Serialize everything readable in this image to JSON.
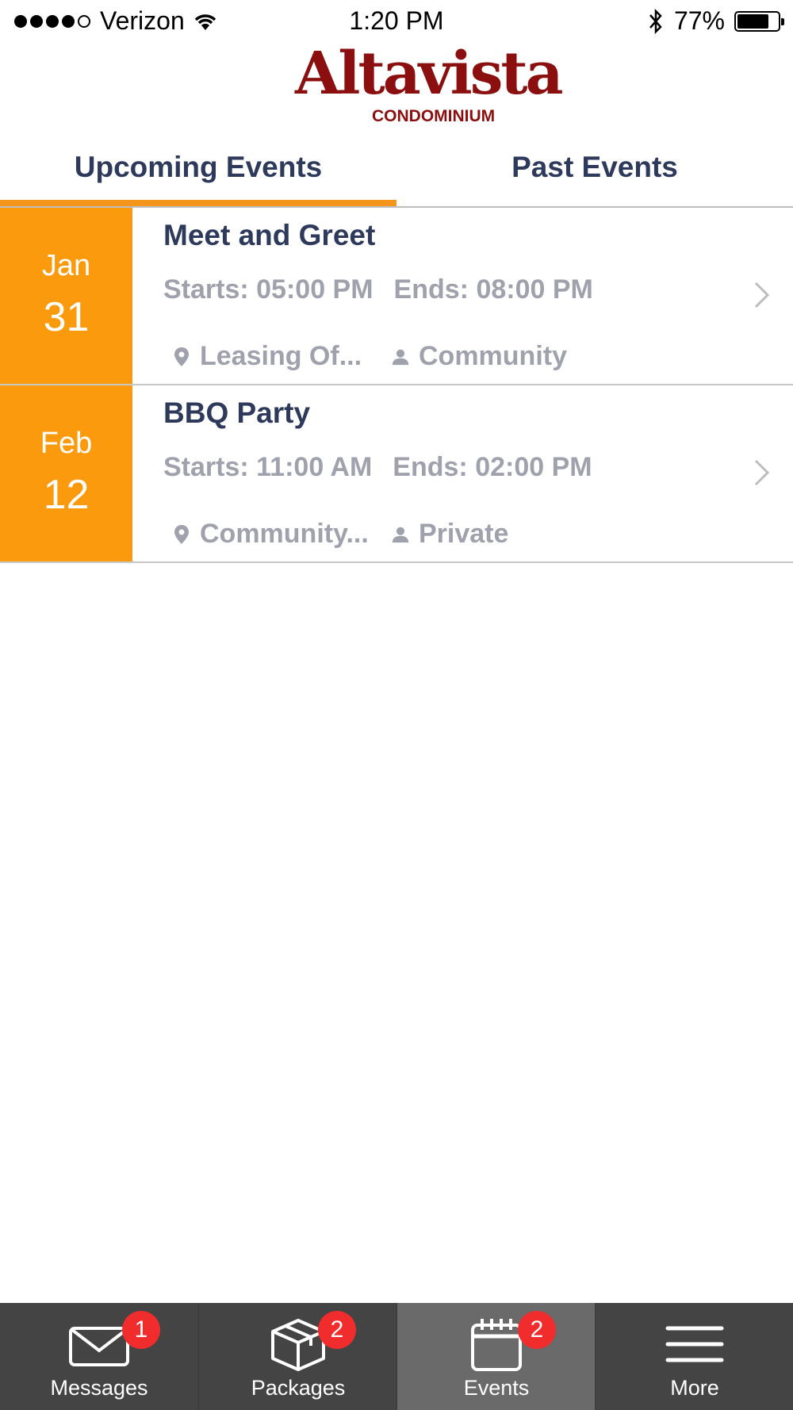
{
  "status_bar": {
    "carrier": "Verizon",
    "time": "1:20 PM",
    "battery_percent": "77%",
    "battery_level": 0.77,
    "signal_bars": 4,
    "signal_max": 5
  },
  "logo": {
    "main": "Altavista",
    "sub": "CONDOMINIUM",
    "color": "#8b0f0f"
  },
  "tabs": {
    "upcoming": "Upcoming Events",
    "past": "Past Events",
    "active": "upcoming",
    "accent": "#f5951b"
  },
  "events": [
    {
      "month": "Jan",
      "day": "31",
      "title": "Meet and Greet",
      "starts": "Starts: 05:00 PM",
      "ends": "Ends: 08:00 PM",
      "location": "Leasing Of...",
      "category": "Community"
    },
    {
      "month": "Feb",
      "day": "12",
      "title": "BBQ Party",
      "starts": "Starts: 11:00 AM",
      "ends": "Ends: 02:00 PM",
      "location": "Community...",
      "category": "Private"
    }
  ],
  "tab_bar": {
    "messages": {
      "label": "Messages",
      "badge": "1",
      "icon": "envelope-icon"
    },
    "packages": {
      "label": "Packages",
      "badge": "2",
      "icon": "box-icon"
    },
    "events": {
      "label": "Events",
      "badge": "2",
      "icon": "calendar-icon"
    },
    "more": {
      "label": "More",
      "icon": "menu-icon"
    },
    "active": "events"
  },
  "colors": {
    "date_block": "#fb9a0d",
    "title_text": "#2e3a5c",
    "meta_text": "#9fa1ad",
    "tab_bar_bg": "#444444",
    "badge": "#f12c2c"
  }
}
